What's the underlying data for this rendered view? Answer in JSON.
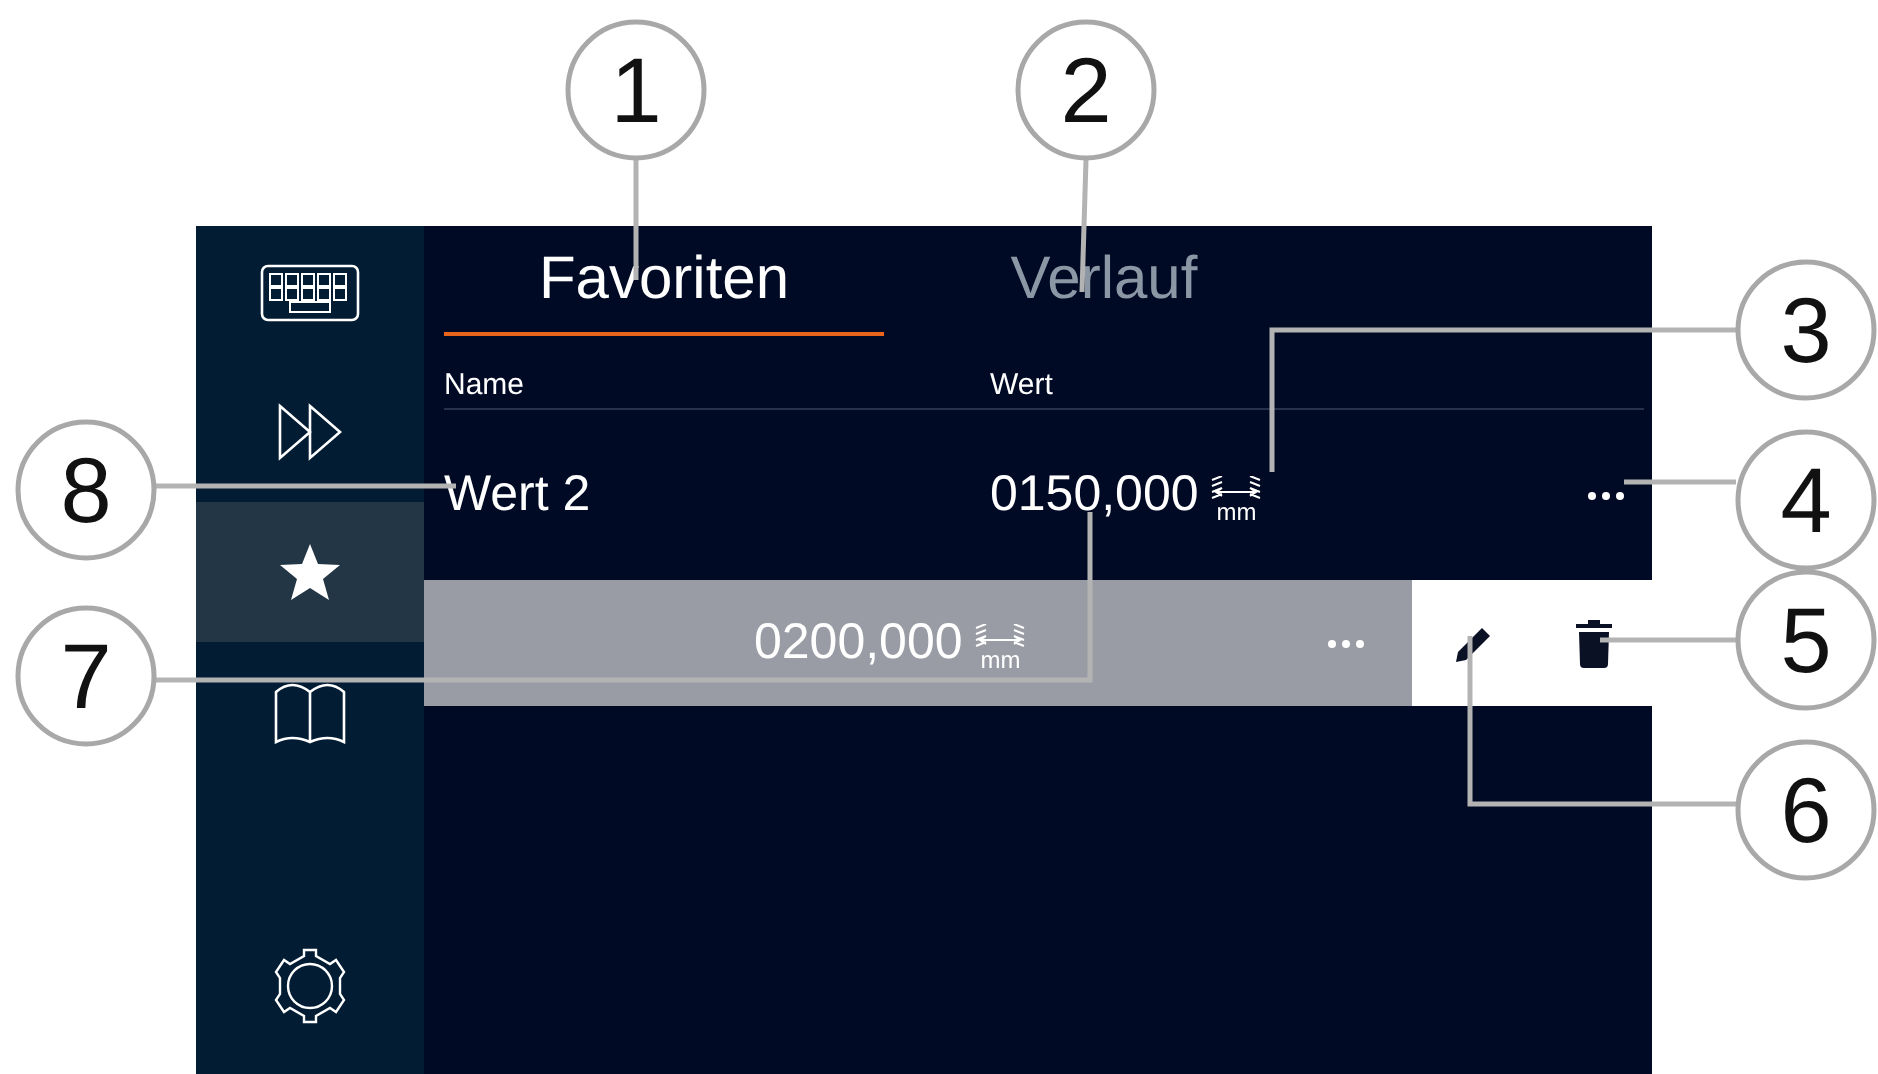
{
  "sidebar": {
    "items": [
      {
        "kind": "keyboard",
        "selected": false
      },
      {
        "kind": "forward",
        "selected": false
      },
      {
        "kind": "star",
        "selected": true
      },
      {
        "kind": "book",
        "selected": false
      },
      {
        "kind": "gear",
        "selected": false
      }
    ]
  },
  "tabs": [
    {
      "label": "Favoriten",
      "selected": true
    },
    {
      "label": "Verlauf",
      "selected": false
    }
  ],
  "table": {
    "columns": [
      "Name",
      "Wert"
    ],
    "rows": [
      {
        "name": "Wert 2",
        "value": "0150,000",
        "unit": "mm",
        "swiped": false
      },
      {
        "value": "0200,000",
        "unit": "mm",
        "swiped": true
      }
    ]
  },
  "callouts": [
    {
      "label": "1"
    },
    {
      "label": "2"
    },
    {
      "label": "3"
    },
    {
      "label": "4"
    },
    {
      "label": "5"
    },
    {
      "label": "6"
    },
    {
      "label": "7"
    },
    {
      "label": "8"
    }
  ]
}
